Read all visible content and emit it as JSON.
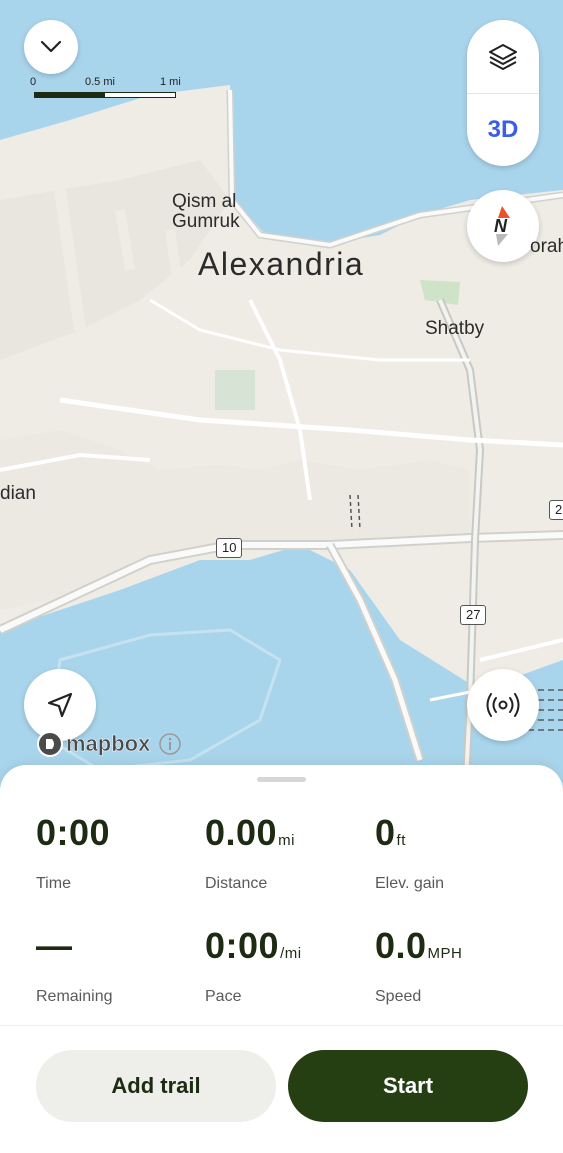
{
  "map": {
    "scale": {
      "start": "0",
      "mid": "0.5 mi",
      "end": "1 mi"
    },
    "labels": {
      "district1_line1": "Qism al",
      "district1_line2": "Gumruk",
      "city": "Alexandria",
      "district2": "Shatby",
      "district3": "dian",
      "partial": "orah"
    },
    "road_shields": {
      "r10": "10",
      "r27": "27",
      "r2": "2"
    },
    "attribution": "mapbox",
    "layers_3d_label": "3D"
  },
  "stats": [
    {
      "value": "0:00",
      "unit": "",
      "label": "Time"
    },
    {
      "value": "0.00",
      "unit": "mi",
      "label": "Distance"
    },
    {
      "value": "0",
      "unit": "ft",
      "label": "Elev. gain"
    },
    {
      "value": "—",
      "unit": "",
      "label": "Remaining"
    },
    {
      "value": "0:00",
      "unit": "/mi",
      "label": "Pace"
    },
    {
      "value": "0.0",
      "unit": "MPH",
      "label": "Speed"
    }
  ],
  "actions": {
    "add_trail": "Add trail",
    "start": "Start"
  },
  "colors": {
    "water": "#a8d4ec",
    "land": "#eeece4",
    "accent": "#3b5de7",
    "start_btn": "#253f13"
  }
}
